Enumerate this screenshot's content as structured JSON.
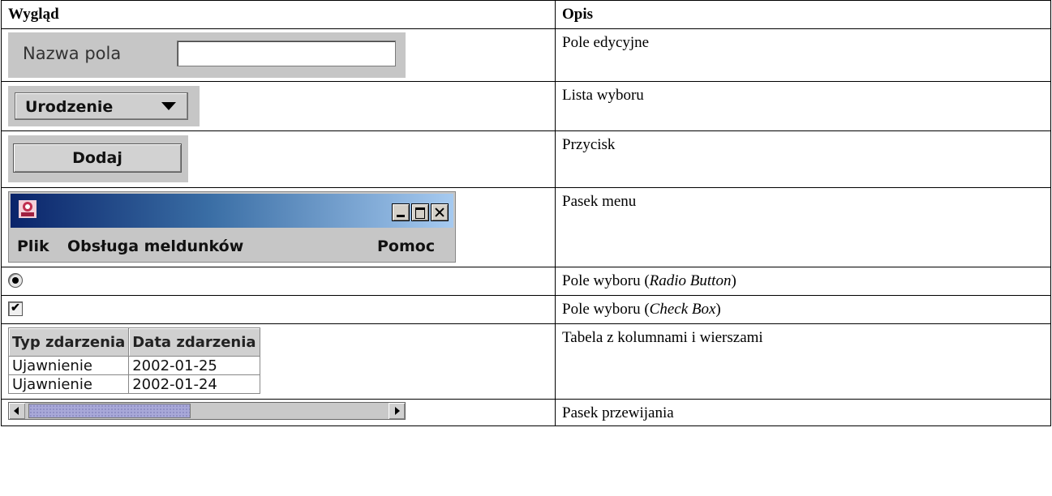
{
  "header": {
    "col_appearance": "Wygląd",
    "col_description": "Opis"
  },
  "rows": {
    "edit_field": {
      "label": "Nazwa pola",
      "value": "",
      "description": "Pole edycyjne"
    },
    "combo": {
      "selected": "Urodzenie",
      "description": "Lista wyboru"
    },
    "button": {
      "label": "Dodaj",
      "description": "Przycisk"
    },
    "menubar": {
      "items": [
        "Plik",
        "Obsługa meldunków",
        "Pomoc"
      ],
      "window_buttons": [
        "minimize",
        "maximize",
        "close"
      ],
      "description": "Pasek menu"
    },
    "radio": {
      "checked": true,
      "description_prefix": "Pole wyboru (",
      "description_em": "Radio Button",
      "description_suffix": ")"
    },
    "checkbox": {
      "checked": true,
      "mark": "✔",
      "description_prefix": "Pole wyboru (",
      "description_em": "Check Box",
      "description_suffix": ")"
    },
    "table": {
      "columns": [
        "Typ zdarzenia",
        "Data zdarzenia"
      ],
      "rows": [
        [
          "Ujawnienie",
          "2002-01-25"
        ],
        [
          "Ujawnienie",
          "2002-01-24"
        ]
      ],
      "description": "Tabela z kolumnami i wierszami"
    },
    "scrollbar": {
      "position": 0.06,
      "description": "Pasek przewijania"
    }
  },
  "colors": {
    "panel_bg": "#c6c6c6",
    "title_gradient_start": "#0a246a",
    "title_gradient_end": "#a6caf0"
  }
}
